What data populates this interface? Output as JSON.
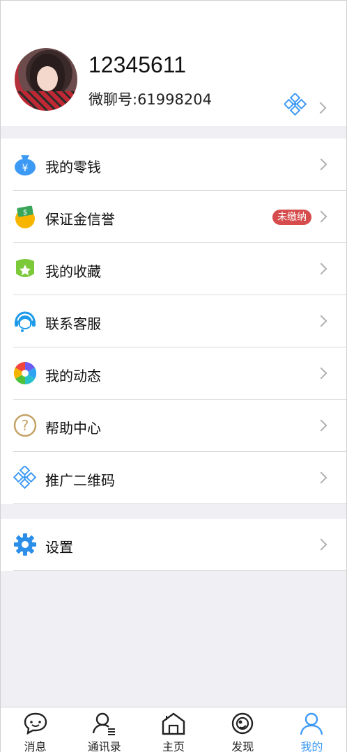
{
  "profile": {
    "name": "12345611",
    "wechat_id": "微聊号:61998204"
  },
  "menu_group_1": [
    {
      "label": "我的零钱",
      "icon": "money-bag-icon"
    },
    {
      "label": "保证金信誉",
      "icon": "deposit-icon",
      "badge": "未缴纳"
    },
    {
      "label": "我的收藏",
      "icon": "star-icon"
    },
    {
      "label": "联系客服",
      "icon": "headset-icon"
    },
    {
      "label": "我的动态",
      "icon": "pinwheel-icon"
    },
    {
      "label": "帮助中心",
      "icon": "question-icon"
    },
    {
      "label": "推广二维码",
      "icon": "qrcode-icon"
    }
  ],
  "menu_group_2": [
    {
      "label": "设置",
      "icon": "gear-icon"
    }
  ],
  "tabs": [
    {
      "label": "消息",
      "icon": "chat-icon"
    },
    {
      "label": "通讯录",
      "icon": "contacts-icon"
    },
    {
      "label": "主页",
      "icon": "home-icon"
    },
    {
      "label": "发现",
      "icon": "discover-icon"
    },
    {
      "label": "我的",
      "icon": "user-icon",
      "active": true
    }
  ],
  "colors": {
    "accent": "#3d9af4",
    "badge": "#d64b4b",
    "background": "#efeff4"
  }
}
